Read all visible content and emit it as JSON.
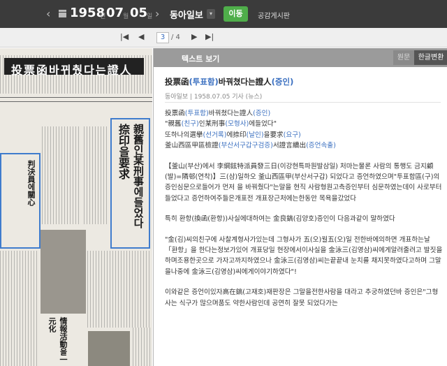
{
  "topbar": {
    "prev_arrow": "‹",
    "next_arrow": "›",
    "year": "1958",
    "year_suffix": "년",
    "month": "07",
    "month_suffix": "월",
    "day": "05",
    "day_suffix": "일",
    "paper_name": "동아일보",
    "paper_dropdown_arrow": "▾",
    "go_button": "이동",
    "board_link": "공감게시판"
  },
  "pager": {
    "first": "|◀",
    "prev": "◀",
    "current_page": "3",
    "total": "/ 4",
    "next": "▶",
    "last": "▶|"
  },
  "newspaper": {
    "headline": "投票函바뀌췄다는證人",
    "vertical_title_1": "親舊인某刑事에들었다",
    "vertical_title_2": "捺印을要求",
    "vertical_title_3": "判決員에關心",
    "vertical_title_4": "情報活動을一元化"
  },
  "panel": {
    "title": "텍스트 보기",
    "tab_original": "원문",
    "tab_converted": "한글변환"
  },
  "article": {
    "title_a": "投票函",
    "title_b": "(투표함)",
    "title_c": "바꿔쳤다는證人",
    "title_d": "(증인)",
    "meta": "동아일보 | 1958.07.05 기사 (뉴스)",
    "l1a": "投票函",
    "l1b": "(투표함)",
    "l1c": "바꿔쳤다는證人",
    "l1d": "(증인)",
    "l2a": "\"親舊",
    "l2b": "(친구)",
    "l2c": "인某刑事",
    "l2d": "(모형사)",
    "l2e": "에들었다\"",
    "l3a": "또하나의選擧",
    "l3b": "(선거록)",
    "l3c": "에捺印",
    "l3d": "(날인)",
    "l3e": "을要求",
    "l3f": "(요구)",
    "l4a": "釜山西區甲區檢證",
    "l4b": "(부산서구갑구검증)",
    "l4c": "서證言續出",
    "l4d": "(증언속출)",
    "p1": "【釜山(부산)에서 李綱鉉特派員發三日(이강현특파원발삼일) 처마는물론 사람의 통행도 금지顧(발)=隣邨(연착)】三(삼)일하오 釜山西區甲(부산서구갑) 되었다고 증언하였으며\"투표함區(구)의 증인심문으로들어가 먼저 을 바꿔췄다\"는말을 현직 사람형원고측증인부터 심문하였는데이 사로부터 들었다고 증언하여주들은개표전 개표장근처에는한동안 목욕을갔었다",
    "p2": "특히 환항(換函(환항))사실에대하여는 金良鎬(김양호)증인이 다음과같이 말하였다",
    "p3": "\"金(김)씨의친구에 사찰계형사가있는데 그형사가 五(오)월五(오)일 전한바에의하면 개표하는날「환항」을 한다는정보가있어 개표당일 현장에서이사실을 金泳三(김영삼)씨에게알려줄려고 발짓을하며조용한곳으로 가자고까지하였으나 金泳三(김영삼)씨는끝끝내 눈치를 채지못하였다고하며 그말을나중에 金泳三(김영삼)씨에게이야기하였다\"!",
    "p4": "이와같은 증언이있자高在鎬(고재호)재판장은 그말을전한사람을 대라고 추궁하였던바 증인은\"그형사는 식구가 많으며품도 약한사람인데 공연히 잘못 되었다가는"
  }
}
